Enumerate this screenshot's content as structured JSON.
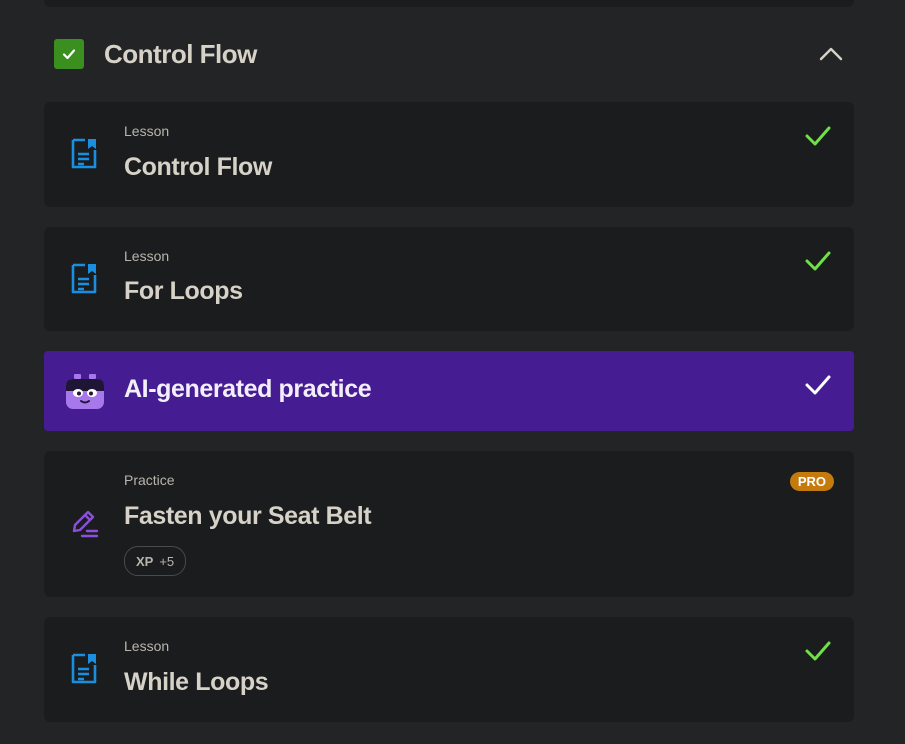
{
  "section": {
    "title": "Control Flow",
    "completed": true
  },
  "items": [
    {
      "kind": "Lesson",
      "title": "Control Flow",
      "status": "complete",
      "icon": "lesson-document-icon"
    },
    {
      "kind": "Lesson",
      "title": "For Loops",
      "status": "complete",
      "icon": "lesson-document-icon"
    },
    {
      "kind": "",
      "title": "AI-generated practice",
      "status": "complete",
      "icon": "robot-mascot-icon"
    },
    {
      "kind": "Practice",
      "title": "Fasten your Seat Belt",
      "status": "incomplete",
      "icon": "pencil-edit-icon",
      "badge": "PRO",
      "xp_label": "XP",
      "xp_value": "+5"
    },
    {
      "kind": "Lesson",
      "title": "While Loops",
      "status": "complete",
      "icon": "lesson-document-icon"
    }
  ],
  "colors": {
    "background": "#232425",
    "card": "#1b1c1e",
    "ai_card": "#461c93",
    "check_green": "#6fe045",
    "lesson_icon_blue": "#1a8fe0",
    "practice_icon_purple": "#8a4fdc",
    "pro_badge": "#c57a0e"
  }
}
